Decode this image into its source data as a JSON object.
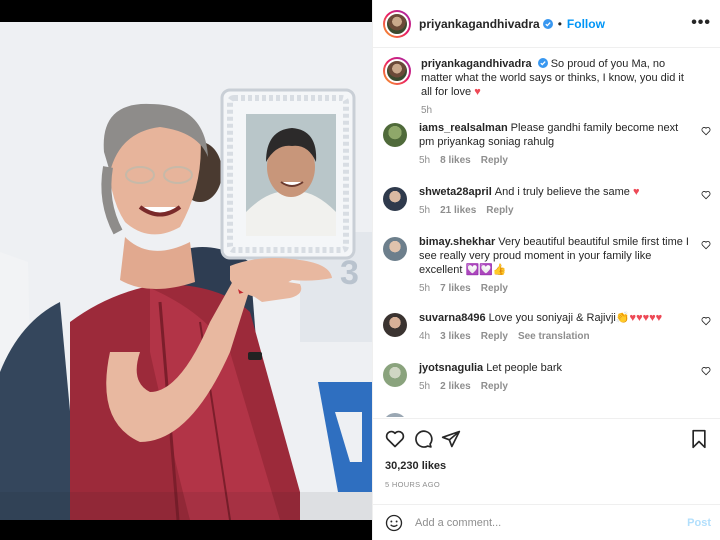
{
  "post": {
    "author": "priyankagandhivadra",
    "follow_label": "Follow",
    "separator": "•",
    "more_label": "•••",
    "caption": "So proud of you Ma, no matter what the world says or thinks, I know, you did it all for love",
    "caption_emoji": "♥",
    "caption_time": "5h",
    "likes": "30,230 likes",
    "age": "5 HOURS AGO",
    "add_comment_placeholder": "Add a comment...",
    "post_label": "Post"
  },
  "comments": [
    {
      "user": "iams_realsalman",
      "text": "Please gandhi family become next pm priyankag soniag rahulg",
      "emoji": "",
      "time": "5h",
      "likes": "8 likes",
      "reply": "Reply",
      "extra": ""
    },
    {
      "user": "shweta28april",
      "text": "And i truly believe the same",
      "emoji": "♥",
      "time": "5h",
      "likes": "21 likes",
      "reply": "Reply",
      "extra": ""
    },
    {
      "user": "bimay.shekhar",
      "text": "Very beautiful beautiful smile first time I see really very proud moment in your family like excellent",
      "emoji": "💟💟👍",
      "time": "5h",
      "likes": "7 likes",
      "reply": "Reply",
      "extra": ""
    },
    {
      "user": "suvarna8496",
      "text": "Love you soniyaji & Rajivji",
      "emoji": "👏♥♥♥♥♥",
      "time": "4h",
      "likes": "3 likes",
      "reply": "Reply",
      "extra": "See translation"
    },
    {
      "user": "jyotsnagulia",
      "text": "Let people bark",
      "emoji": "",
      "time": "5h",
      "likes": "2 likes",
      "reply": "Reply",
      "extra": ""
    }
  ],
  "icons": [
    "verified-badge-icon",
    "heart-icon",
    "comment-icon",
    "share-icon",
    "bookmark-icon",
    "emoji-icon",
    "more-icon"
  ],
  "colors": {
    "accent": "#0095f6",
    "verified": "#3897f0",
    "heart_red": "#ed4956",
    "muted": "#8e8e8e"
  }
}
